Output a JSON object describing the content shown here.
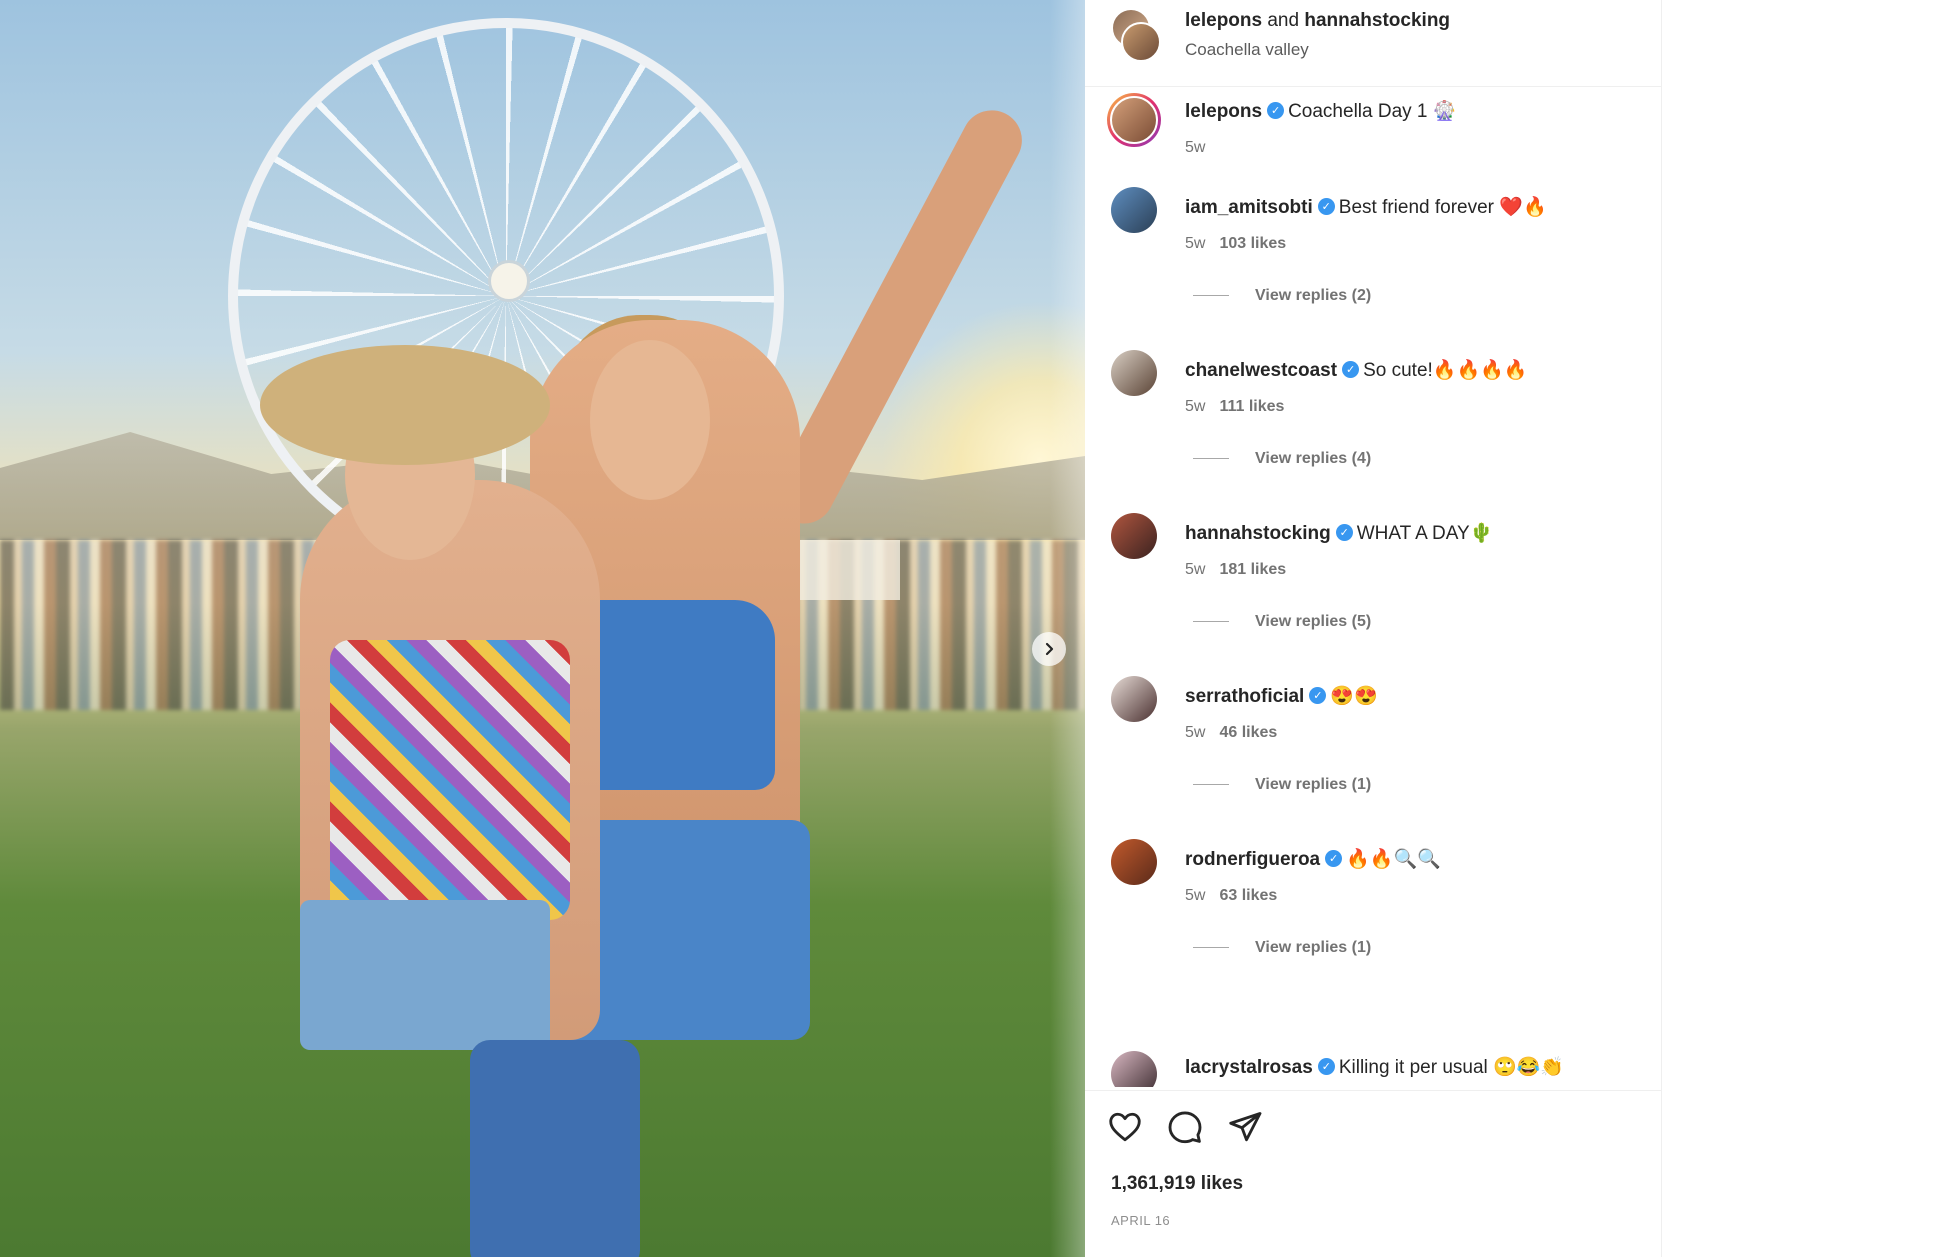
{
  "header": {
    "user1": "lelepons",
    "conjunction": "and",
    "user2": "hannahstocking",
    "location": "Coachella valley"
  },
  "caption": {
    "username": "lelepons",
    "text": "Coachella Day 1 🎡",
    "time": "5w"
  },
  "comments": [
    {
      "username": "iam_amitsobti",
      "text": "Best friend forever ❤️🔥",
      "time": "5w",
      "likes": "103 likes",
      "replies": "View replies (2)"
    },
    {
      "username": "chanelwestcoast",
      "text": "So cute!🔥🔥🔥🔥",
      "time": "5w",
      "likes": "111 likes",
      "replies": "View replies (4)"
    },
    {
      "username": "hannahstocking",
      "text": "WHAT A DAY🌵",
      "time": "5w",
      "likes": "181 likes",
      "replies": "View replies (5)"
    },
    {
      "username": "serrathoficial",
      "text": "😍😍",
      "time": "5w",
      "likes": "46 likes",
      "replies": "View replies (1)"
    },
    {
      "username": "rodnerfigueroa",
      "text": "🔥🔥🔍🔍",
      "time": "5w",
      "likes": "63 likes",
      "replies": "View replies (1)"
    },
    {
      "username": "lacrystalrosas",
      "text": "Killing it per usual 🙄😂👏"
    }
  ],
  "footer": {
    "likes": "1,361,919 likes",
    "date": "APRIL 16"
  },
  "icons": {
    "like": "heart-icon",
    "comment": "comment-icon",
    "share": "share-icon",
    "next": "chevron-right-icon",
    "verified": "verified-badge-icon"
  },
  "colors": {
    "verified": "#3897f0",
    "text": "#262626",
    "muted": "#737373"
  }
}
